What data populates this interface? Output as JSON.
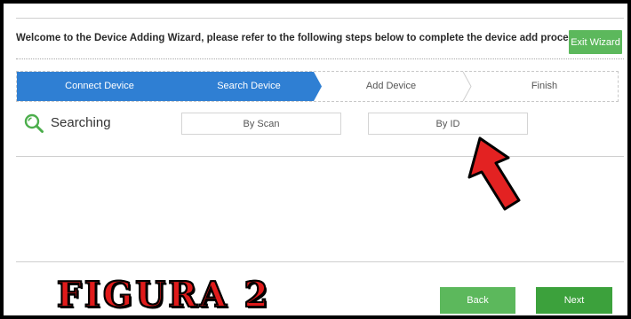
{
  "wizard": {
    "welcome_text": "Welcome to the Device Adding Wizard, please refer to the following steps below to complete the device add process:",
    "exit_label": "Exit Wizard"
  },
  "steps": [
    {
      "label": "Connect Device",
      "state": "done"
    },
    {
      "label": "Search Device",
      "state": "active"
    },
    {
      "label": "Add Device",
      "state": "pending"
    },
    {
      "label": "Finish",
      "state": "pending"
    }
  ],
  "search": {
    "status_label": "Searching",
    "icon": "search-icon",
    "by_scan_label": "By Scan",
    "by_id_label": "By ID"
  },
  "footer": {
    "back_label": "Back",
    "next_label": "Next"
  },
  "overlay": {
    "caption": "FIGURA 2",
    "pointer_icon": "red-arrow-icon"
  },
  "colors": {
    "step_active": "#2f7fd3",
    "button_green": "#5cb85c",
    "next_green": "#3ca13c",
    "caption_red": "#e01b1b",
    "search_icon": "#4cae4c"
  }
}
